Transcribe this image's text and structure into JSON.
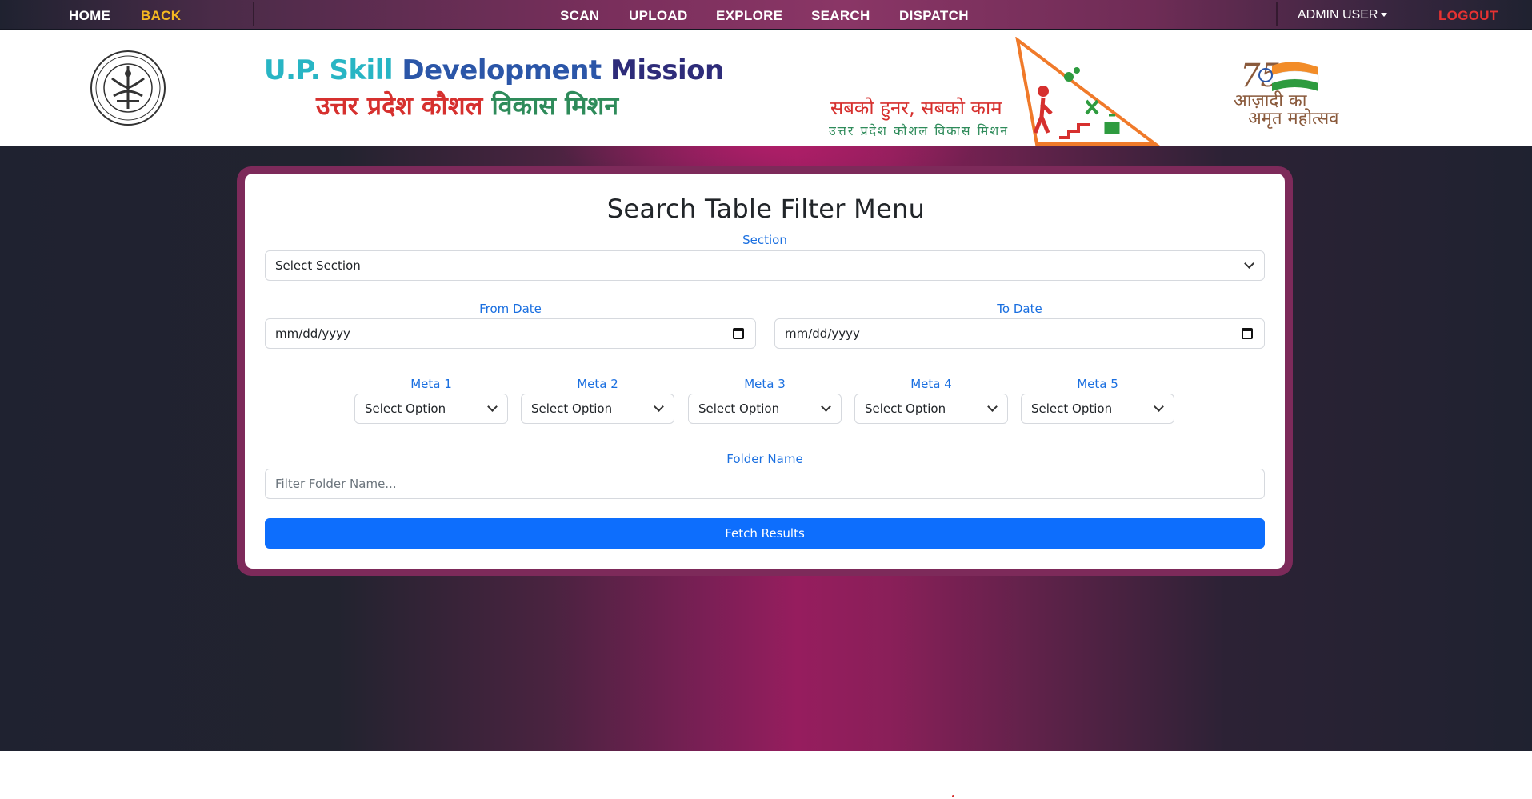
{
  "nav": {
    "home": "HOME",
    "back": "BACK",
    "scan": "SCAN",
    "upload": "UPLOAD",
    "explore": "EXPLORE",
    "search": "SEARCH",
    "dispatch": "DISPATCH",
    "user": "ADMIN USER",
    "logout": "LOGOUT"
  },
  "header": {
    "title_en_part1": "U.P. Skill ",
    "title_en_part2": "Development ",
    "title_en_part3": "Mission",
    "title_hi_part1": "उत्तर प्रदेश कौशल ",
    "title_hi_part2": "विकास मिशन",
    "slogan": "सबको हुनर, सबको काम",
    "slogan_sub": "उत्तर प्रदेश कौशल विकास मिशन",
    "azadi_line1": "आज़ादी का",
    "azadi_line2": "अमृत महोत्सव"
  },
  "form": {
    "title": "Search Table Filter Menu",
    "section_label": "Section",
    "section_value": "Select Section",
    "from_date_label": "From Date",
    "from_date_value": "mm/dd/yyyy",
    "to_date_label": "To Date",
    "to_date_value": "mm/dd/yyyy",
    "meta": [
      {
        "label": "Meta 1",
        "value": "Select Option"
      },
      {
        "label": "Meta 2",
        "value": "Select Option"
      },
      {
        "label": "Meta 3",
        "value": "Select Option"
      },
      {
        "label": "Meta 4",
        "value": "Select Option"
      },
      {
        "label": "Meta 5",
        "value": "Select Option"
      }
    ],
    "folder_label": "Folder Name",
    "folder_placeholder": "Filter Folder Name...",
    "fetch_button": "Fetch Results"
  },
  "colors": {
    "accent": "#0d6efd",
    "label": "#1a6fe0",
    "back": "#f5b921",
    "logout": "#e63232"
  }
}
